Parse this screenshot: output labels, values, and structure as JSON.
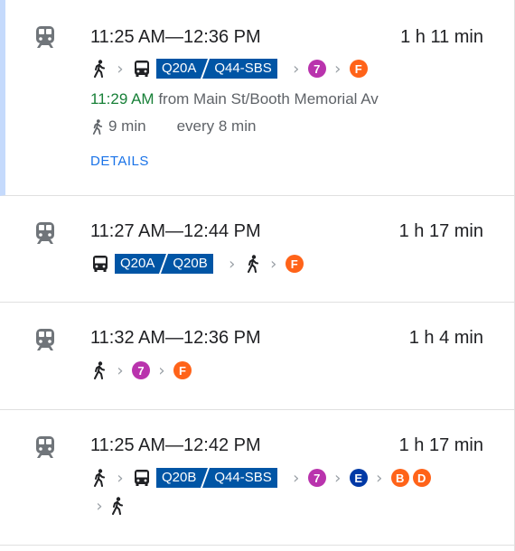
{
  "routes": [
    {
      "time": "11:25 AM—12:36 PM",
      "duration": "1 h 11 min",
      "departure_time": "11:29 AM",
      "departure_place": "from Main St/Booth Memorial Av",
      "walk_time": "9 min",
      "frequency": "every 8 min",
      "details_label": "DETAILS",
      "buses": [
        "Q20A",
        "Q44-SBS"
      ],
      "lines": [
        "7",
        "F"
      ]
    },
    {
      "time": "11:27 AM—12:44 PM",
      "duration": "1 h 17 min",
      "buses": [
        "Q20A",
        "Q20B"
      ],
      "lines": [
        "F"
      ]
    },
    {
      "time": "11:32 AM—12:36 PM",
      "duration": "1 h 4 min",
      "lines": [
        "7",
        "F"
      ]
    },
    {
      "time": "11:25 AM—12:42 PM",
      "duration": "1 h 17 min",
      "buses": [
        "Q20B",
        "Q44-SBS"
      ],
      "lines": [
        "7",
        "E",
        "B",
        "D"
      ]
    }
  ],
  "icons": {
    "mode": "train-icon",
    "walk": "walk-icon",
    "bus": "bus-icon",
    "chevron": "chevron-right-icon"
  },
  "colors": {
    "line_7": "#b933ad",
    "line_F": "#ff6319",
    "line_E": "#0039a6",
    "line_B": "#ff6319",
    "line_D": "#ff6319",
    "bus_badge": "#0055a5",
    "selected_bar": "#c5dafc",
    "departure_green": "#188038",
    "details_blue": "#1a73e8"
  }
}
